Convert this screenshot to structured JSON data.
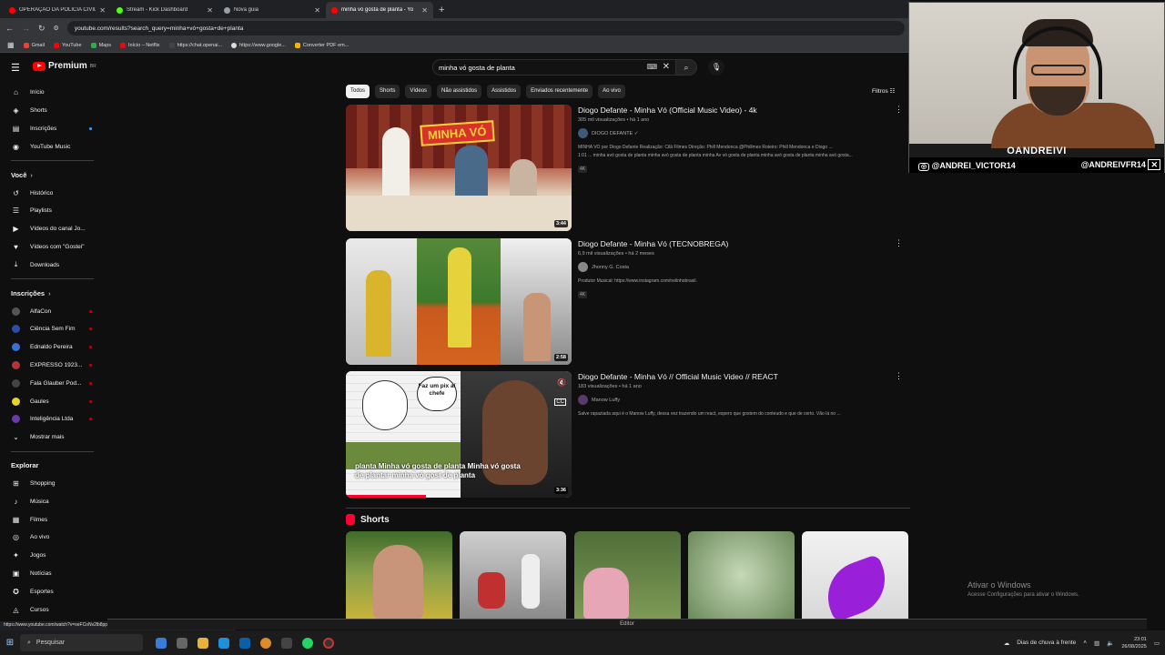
{
  "browser": {
    "tabs": [
      {
        "title": "OPERAÇÃO DA POLÍCIA CIVIL t",
        "color": "#ff0000",
        "active": false
      },
      {
        "title": "Stream - Kick Dashboard",
        "color": "#53fc18",
        "active": false
      },
      {
        "title": "Nova guia",
        "color": "#9aa0a6",
        "active": false
      },
      {
        "title": "minha vó gosta de planta - Yo",
        "color": "#ff0000",
        "active": true
      }
    ],
    "new_tab": "+",
    "url": "youtube.com/results?search_query=minha+vó+gosta+de+planta",
    "bookmarks": [
      {
        "label": "Gmail"
      },
      {
        "label": "YouTube"
      },
      {
        "label": "Maps"
      },
      {
        "label": "Início – Netflix"
      },
      {
        "label": "https://chat.openai..."
      },
      {
        "label": "https://www.google..."
      },
      {
        "label": "Converter PDF em..."
      }
    ]
  },
  "youtube": {
    "logo": "Premium",
    "logo_sup": "BR",
    "search_value": "minha vó gosta de planta",
    "sidebar": {
      "main": [
        {
          "label": "Início",
          "icon": "home-icon",
          "glyph": "⌂"
        },
        {
          "label": "Shorts",
          "icon": "shorts-icon",
          "glyph": "◈"
        },
        {
          "label": "Inscrições",
          "icon": "subscriptions-icon",
          "glyph": "▤"
        },
        {
          "label": "YouTube Music",
          "icon": "music-icon",
          "glyph": "◉"
        }
      ],
      "voce_title": "Você",
      "voce": [
        {
          "label": "Histórico",
          "icon": "history-icon",
          "glyph": "↺"
        },
        {
          "label": "Playlists",
          "icon": "playlists-icon",
          "glyph": "☰"
        },
        {
          "label": "Vídeos do canal Jo...",
          "icon": "your-videos-icon",
          "glyph": "▶"
        },
        {
          "label": "Vídeos com \"Gostei\"",
          "icon": "liked-icon",
          "glyph": "👍"
        },
        {
          "label": "Downloads",
          "icon": "download-icon",
          "glyph": "⤓"
        }
      ],
      "subs_title": "Inscrições",
      "subs": [
        {
          "label": "AlfaCon",
          "color": "#555"
        },
        {
          "label": "Ciência Sem Fim",
          "color": "#2b4fa8"
        },
        {
          "label": "Ednaldo Pereira",
          "color": "#3b6fd8"
        },
        {
          "label": "EXPRESSO 1923...",
          "color": "#b8323c"
        },
        {
          "label": "Fala Glauber Pod...",
          "color": "#444"
        },
        {
          "label": "Gaules",
          "color": "#e8d32a"
        },
        {
          "label": "Inteligência Ltda",
          "color": "#6a3ba8"
        }
      ],
      "show_more": "Mostrar mais",
      "explore_title": "Explorar",
      "explore": [
        {
          "label": "Shopping",
          "icon": "shopping-icon",
          "glyph": "🛍"
        },
        {
          "label": "Música",
          "icon": "music-note-icon",
          "glyph": "♪"
        },
        {
          "label": "Filmes",
          "icon": "movies-icon",
          "glyph": "▦"
        },
        {
          "label": "Ao vivo",
          "icon": "live-icon",
          "glyph": "((•))"
        },
        {
          "label": "Jogos",
          "icon": "gaming-icon",
          "glyph": "🎮"
        },
        {
          "label": "Notícias",
          "icon": "news-icon",
          "glyph": "▣"
        },
        {
          "label": "Esportes",
          "icon": "sports-icon",
          "glyph": "🏆"
        },
        {
          "label": "Cursos",
          "icon": "courses-icon",
          "glyph": "◬"
        }
      ]
    },
    "chips": [
      "Todos",
      "Shorts",
      "Vídeos",
      "Não assistidos",
      "Assistidos",
      "Enviados recentemente",
      "Ao vivo"
    ],
    "filters": "Filtros",
    "videos": [
      {
        "title": "Diogo Defante - Minha Vó (Official Music Video) - 4k",
        "stats": "305 mil visualizações • há 1 ano",
        "channel": "DIOGO DEFANTE ✓",
        "desc1": "MINHA VÓ por Diogo Defante Realização: Cilã Filmes Direção: Phill Mendonca @Phillmes Roteiro: Phill Mendonca e Diogo ...",
        "desc2": "1:01 ... minha avó gosta de planta minha avó gosta de planta minha Av vó gosta de planta minha avó gosta de planta minha avó gosta...",
        "badge": "4K",
        "duration": "3:44"
      },
      {
        "title": "Diogo Defante - Minha Vó (TECNOBREGA)",
        "stats": "6,9 mil visualizações • há 2 meses",
        "channel": "Jhonny G. Costa",
        "desc1": "Produtor Musical: https://www.instagram.com/nelinhobrasil.",
        "desc2": "",
        "badge": "4K",
        "duration": "2:58"
      },
      {
        "title": "Diogo Defante - Minha Vó // Official Music Video // REACT",
        "stats": "183 visualizações • há 1 ano",
        "channel": "Manow Luffy",
        "desc1": "Salve rapaziada aqui é o Manow Luffy, dessa vez trazendo um react, espero que gostem do conteudo e que de certo. Vão lá no ...",
        "desc2": "",
        "badge": "",
        "duration": "3:36",
        "caption": "planta Minha vó gosta de planta Minha vó gosta de plantar minha vó gost de planta",
        "bubble": "Faz um pix aí chefe"
      }
    ],
    "shorts_title": "Shorts",
    "status_url": "https://www.youtube.com/watch?v=xeFCoNv2lb8pp=ygUZbWluaGEgdsOzIGdvc3RhIGRIIHBsYW50YQ%3D%3D",
    "editor_label": "Editor"
  },
  "stream_overlay": {
    "name": "OANDREIVI",
    "instagram": "@ANDREI_VICTOR14",
    "twitter": "@ANDREIVFR14"
  },
  "windows": {
    "activate_title": "Ativar o Windows",
    "activate_sub": "Acesse Configurações para ativar o Windows.",
    "search_placeholder": "Pesquisar",
    "weather": "Dias de chuva à frente",
    "time": "23:01",
    "date": "26/08/2025"
  }
}
